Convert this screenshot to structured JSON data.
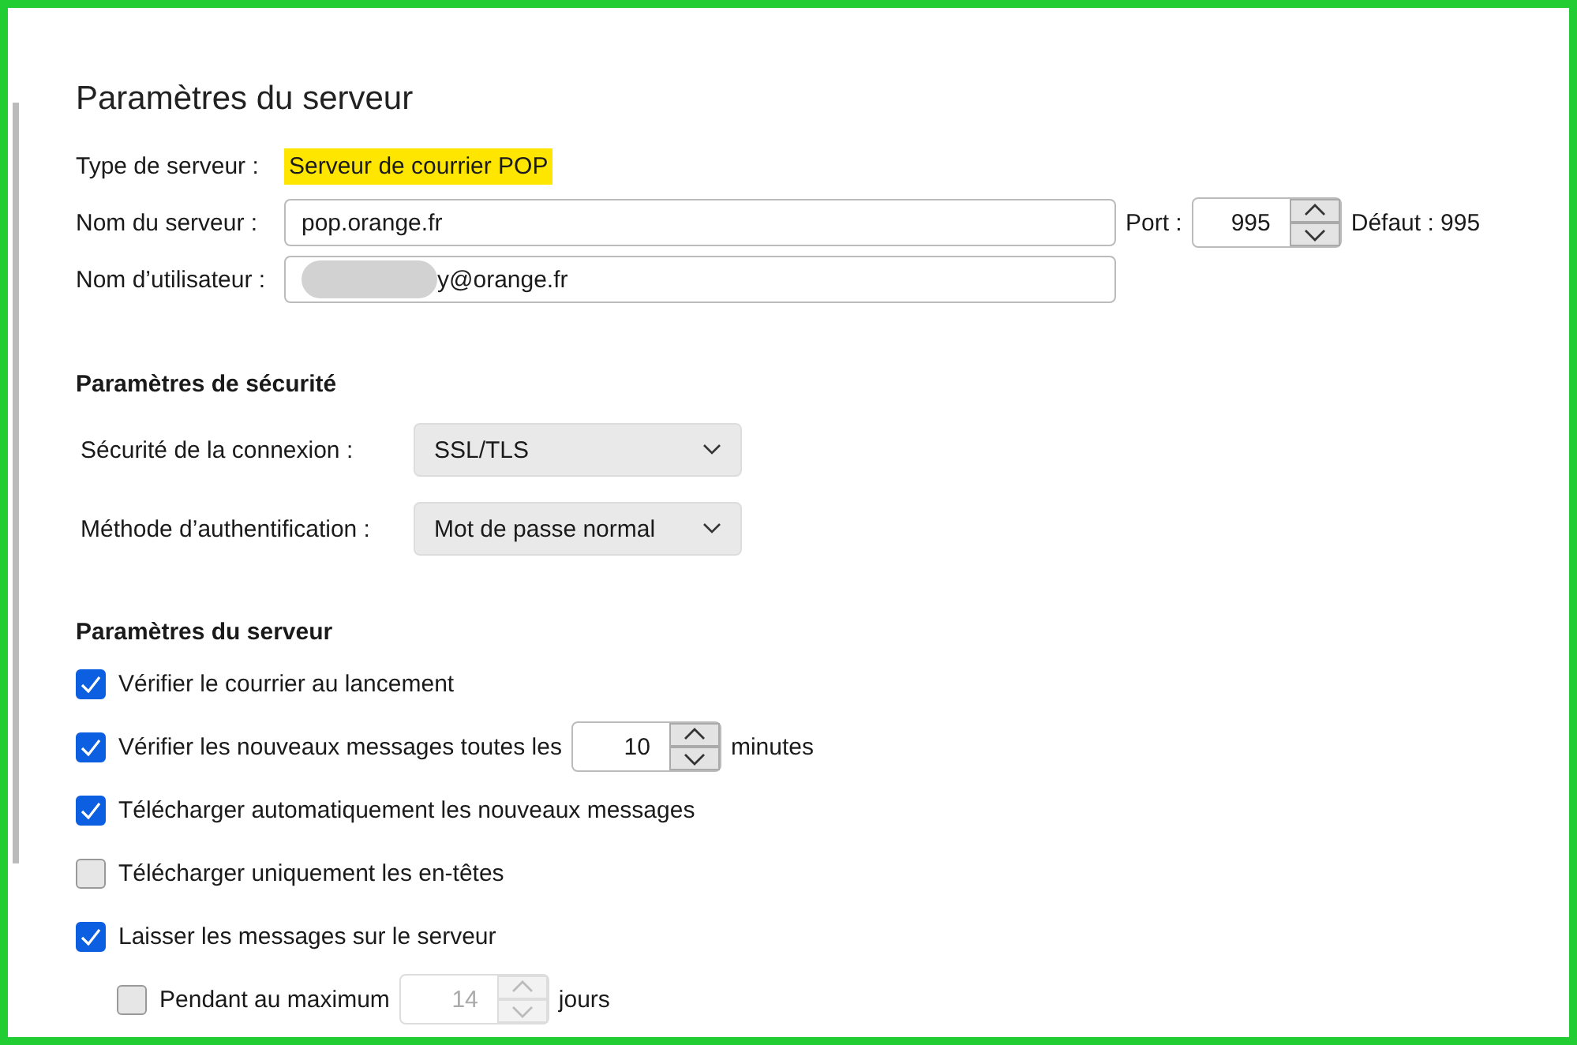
{
  "page_title": "Paramètres du serveur",
  "server": {
    "type_label": "Type de serveur :",
    "type_value": "Serveur de courrier POP",
    "name_label": "Nom du serveur :",
    "name_value": "pop.orange.fr",
    "port_label": "Port :",
    "port_value": "995",
    "default_port": "Défaut : 995",
    "user_label": "Nom d’utilisateur :",
    "user_value": "y@orange.fr"
  },
  "security": {
    "heading": "Paramètres de sécurité",
    "fields": [
      {
        "label": "Sécurité de la connexion :",
        "value": "SSL/TLS"
      },
      {
        "label": "Méthode d’authentification :",
        "value": "Mot de passe normal"
      }
    ]
  },
  "options": {
    "heading": "Paramètres du serveur",
    "items": [
      {
        "kind": "check",
        "label": "Vérifier le courrier au lancement",
        "checked": true
      },
      {
        "kind": "check_number",
        "label": "Vérifier les nouveaux messages toutes les",
        "checked": true,
        "value": "10",
        "unit": "minutes",
        "disabled": false
      },
      {
        "kind": "check",
        "label": "Télécharger automatiquement les nouveaux messages",
        "checked": true
      },
      {
        "kind": "check",
        "label": "Télécharger uniquement les en-têtes",
        "checked": false
      },
      {
        "kind": "check",
        "label": "Laisser les messages sur le serveur",
        "checked": true,
        "children": [
          {
            "kind": "check_number",
            "label": "Pendant au maximum",
            "checked": false,
            "value": "14",
            "unit": "jours",
            "disabled": true
          }
        ]
      }
    ]
  }
}
